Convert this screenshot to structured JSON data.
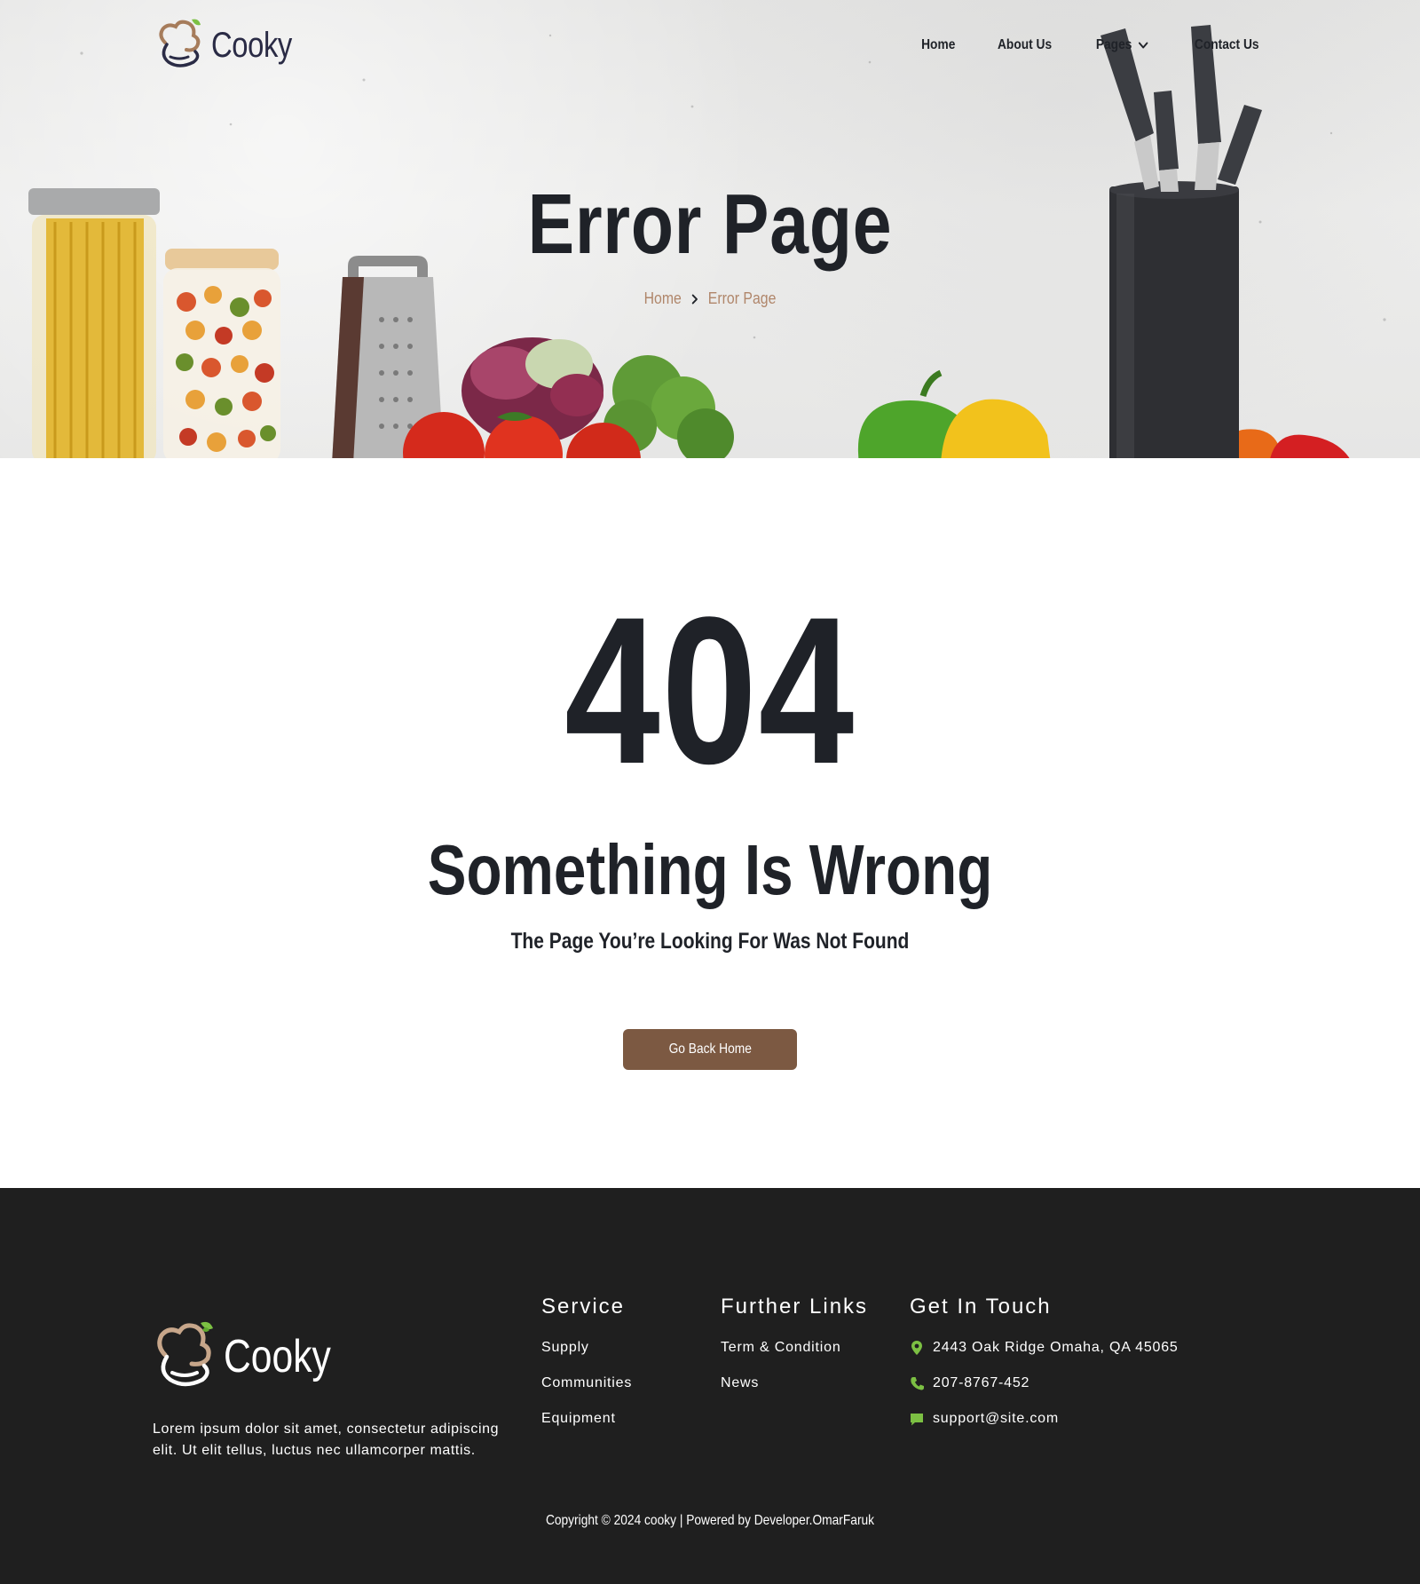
{
  "brand": {
    "name": "Cooky",
    "leaf_color": "#7cc043",
    "mark_color": "#a67c5b",
    "text_color": "#2a2b45"
  },
  "nav": {
    "items": [
      {
        "label": "Home"
      },
      {
        "label": "About Us"
      },
      {
        "label": "Pages",
        "has_dropdown": true
      },
      {
        "label": "Contact Us"
      }
    ]
  },
  "hero": {
    "title": "Error Page",
    "breadcrumb": {
      "home": "Home",
      "current": "Error Page"
    }
  },
  "error": {
    "code": "404",
    "heading": "Something Is Wrong",
    "message": "The Page You’re Looking For Was Not Found",
    "button_label": "Go Back Home",
    "button_color": "#7c5942"
  },
  "footer": {
    "brand_name": "Cooky",
    "about": "Lorem ipsum dolor sit amet, consectetur adipiscing elit. Ut elit tellus, luctus nec ullamcorper mattis.",
    "service": {
      "title": "Service",
      "items": [
        "Supply",
        "Communities",
        "Equipment"
      ]
    },
    "further_links": {
      "title": "Further Links",
      "items": [
        "Term & Condition",
        "News"
      ]
    },
    "get_in_touch": {
      "title": "Get In Touch",
      "address": "2443 Oak Ridge Omaha, QA 45065",
      "phone": "207-8767-452",
      "email": "support@site.com",
      "icon_color": "#7cc043"
    },
    "copyright": "Copyright © 2024 cooky | Powered by Developer.OmarFaruk",
    "background": "#1f1f1f"
  },
  "icons": {
    "chevron": "chevron-down-icon",
    "breadcrumb_sep": "chevron-right-icon",
    "address": "map-pin-icon",
    "phone": "phone-icon",
    "email": "chat-icon"
  }
}
